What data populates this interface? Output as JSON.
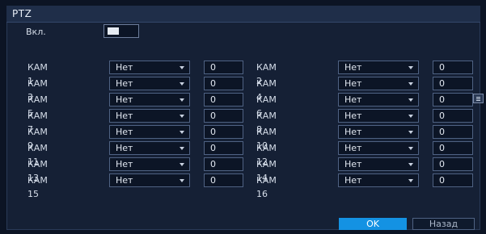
{
  "dialog": {
    "title": "PTZ",
    "enable_label": "Вкл.",
    "enabled": false
  },
  "cameras": [
    {
      "label": "КАМ 1",
      "protocol": "Нет",
      "speed": "0"
    },
    {
      "label": "КАМ 2",
      "protocol": "Нет",
      "speed": "0"
    },
    {
      "label": "КАМ 3",
      "protocol": "Нет",
      "speed": "0"
    },
    {
      "label": "КАМ 4",
      "protocol": "Нет",
      "speed": "0"
    },
    {
      "label": "КАМ 5",
      "protocol": "Нет",
      "speed": "0"
    },
    {
      "label": "КАМ 6",
      "protocol": "Нет",
      "speed": "0"
    },
    {
      "label": "КАМ 7",
      "protocol": "Нет",
      "speed": "0"
    },
    {
      "label": "КАМ 8",
      "protocol": "Нет",
      "speed": "0"
    },
    {
      "label": "КАМ 9",
      "protocol": "Нет",
      "speed": "0"
    },
    {
      "label": "КАМ 10",
      "protocol": "Нет",
      "speed": "0"
    },
    {
      "label": "КАМ 11",
      "protocol": "Нет",
      "speed": "0"
    },
    {
      "label": "КАМ 12",
      "protocol": "Нет",
      "speed": "0"
    },
    {
      "label": "КАМ 13",
      "protocol": "Нет",
      "speed": "0"
    },
    {
      "label": "КАМ 14",
      "protocol": "Нет",
      "speed": "0"
    },
    {
      "label": "КАМ 15",
      "protocol": "Нет",
      "speed": "0"
    },
    {
      "label": "КАМ 16",
      "protocol": "Нет",
      "speed": "0"
    }
  ],
  "buttons": {
    "ok": "OK",
    "back": "Назад"
  },
  "colors": {
    "accent": "#1492e3",
    "background": "#152035",
    "field_border": "#4f6283"
  },
  "icons": {
    "dropdown": "chevron-down-icon",
    "more": "list-icon"
  }
}
